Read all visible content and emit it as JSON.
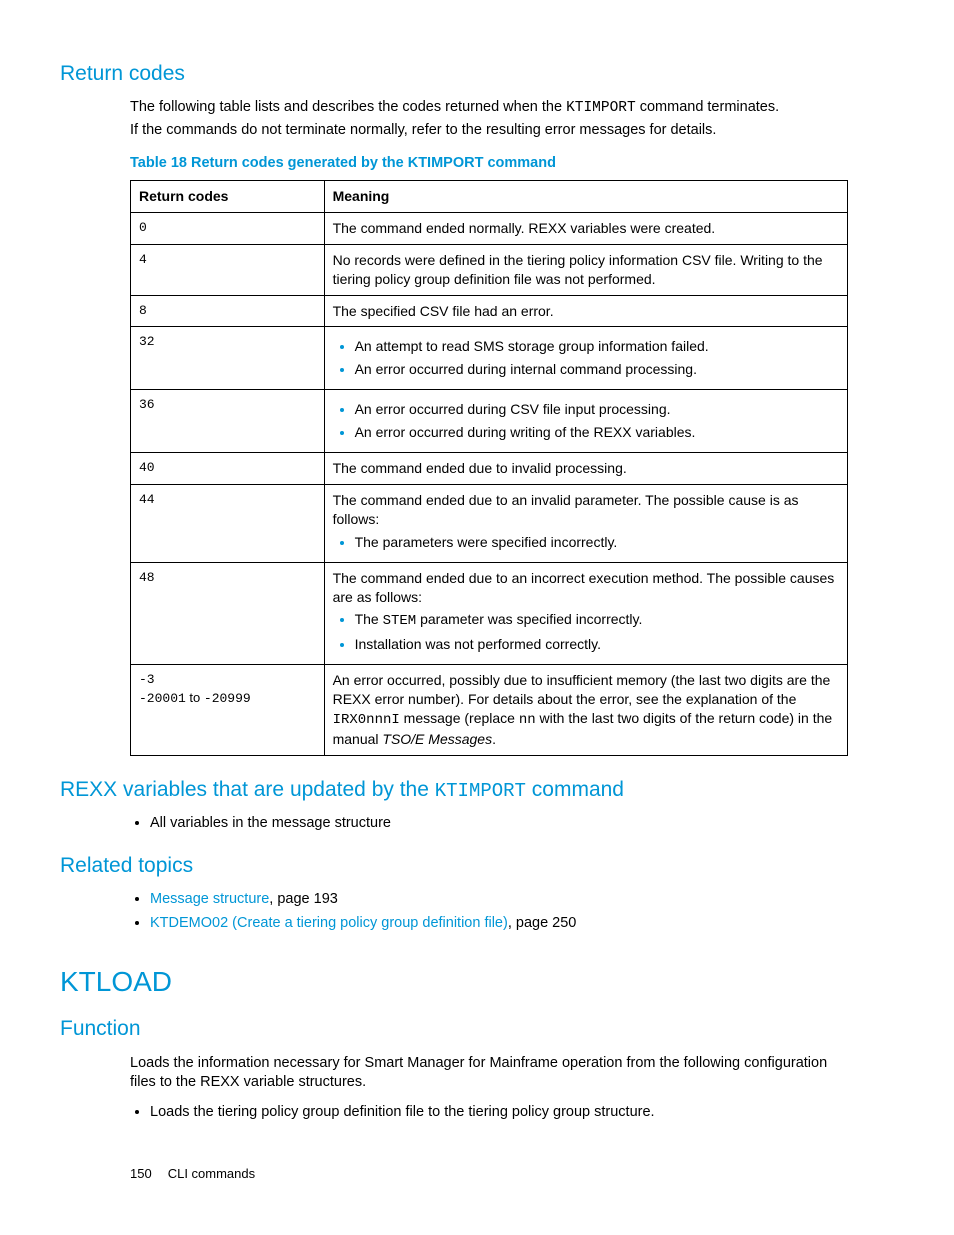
{
  "sections": {
    "return_codes_heading": "Return codes",
    "intro_line1_a": "The following table lists and describes the codes returned when the ",
    "intro_line1_b": "KTIMPORT",
    "intro_line1_c": " command terminates.",
    "intro_line2": "If the commands do not terminate normally, refer to the resulting error messages for details.",
    "table_caption": "Table 18 Return codes generated by the KTIMPORT command",
    "th_code": "Return codes",
    "th_meaning": "Meaning",
    "rows": [
      {
        "code": "0",
        "plain": "The command ended normally. REXX variables were created."
      },
      {
        "code": "4",
        "plain": "No records were defined in the tiering policy information CSV file. Writing to the tiering policy group definition file was not performed."
      },
      {
        "code": "8",
        "plain": "The specified CSV file had an error."
      },
      {
        "code": "32",
        "bullets": [
          "An attempt to read SMS storage group information failed.",
          "An error occurred during internal command processing."
        ]
      },
      {
        "code": "36",
        "bullets": [
          "An error occurred during CSV file input processing.",
          "An error occurred during writing of the REXX variables."
        ]
      },
      {
        "code": "40",
        "plain": "The command ended due to invalid processing."
      },
      {
        "code": "44",
        "lead": "The command ended due to an invalid parameter. The possible cause is as follows:",
        "bullets": [
          "The parameters were specified incorrectly."
        ]
      },
      {
        "code": "48",
        "lead": "The command ended due to an incorrect execution method. The possible causes are as follows:",
        "bullets_rich": [
          {
            "pre": "The ",
            "mono": "STEM",
            "post": " parameter was specified incorrectly."
          },
          {
            "pre": "Installation was not performed correctly.",
            "mono": "",
            "post": ""
          }
        ]
      },
      {
        "code_a": "-3",
        "code_mid": "",
        "code_b": "",
        "code_range": true,
        "code_line1": "-3",
        "code_line2_a": "-20001",
        "code_line2_mid": " to ",
        "code_line2_b": "-20999",
        "rich": {
          "t1": "An error occurred, possibly due to insufficient memory (the last two digits are the REXX error number). For details about the error, see the explanation of the ",
          "m1": "IRX0nnnI",
          "t2": " message (replace ",
          "m2": "nn",
          "t3": " with the last two digits of the return code) in the manual ",
          "it": "TSO/E Messages",
          "t4": "."
        }
      }
    ],
    "rexx_heading_a": "REXX variables that are updated by the ",
    "rexx_heading_b": "KTIMPORT",
    "rexx_heading_c": " command",
    "rexx_bullet": "All variables in the message structure",
    "related_heading": "Related topics",
    "related_items": [
      {
        "link": "Message structure",
        "rest": ", page 193"
      },
      {
        "link": "KTDEMO02 (Create a tiering policy group definition file)",
        "rest": ", page 250"
      }
    ],
    "ktload_heading": "KTLOAD",
    "function_heading": "Function",
    "function_p1": "Loads the information necessary for Smart Manager for Mainframe operation from the following configuration files to the REXX variable structures.",
    "function_bullet": "Loads the tiering policy group definition file to the tiering policy group structure."
  },
  "footer": {
    "page": "150",
    "label": "CLI commands"
  }
}
